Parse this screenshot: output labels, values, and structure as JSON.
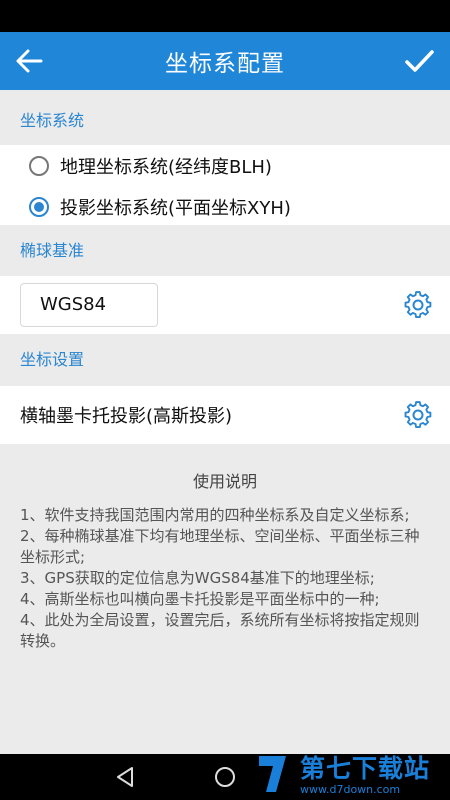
{
  "appbar": {
    "title": "坐标系配置",
    "back_icon": "arrow-left-icon",
    "confirm_icon": "check-icon"
  },
  "coordinate_system": {
    "header": "坐标系统",
    "options": [
      {
        "label": "地理坐标系统(经纬度BLH)",
        "selected": false
      },
      {
        "label": "投影坐标系统(平面坐标XYH)",
        "selected": true
      }
    ]
  },
  "ellipsoid": {
    "header": "椭球基准",
    "value": "WGS84",
    "settings_icon": "gear-icon"
  },
  "coordinate_settings": {
    "header": "坐标设置",
    "value": "横轴墨卡托投影(高斯投影)",
    "settings_icon": "gear-icon"
  },
  "instructions": {
    "title": "使用说明",
    "lines": [
      "1、软件支持我国范围内常用的四种坐标系及自定义坐标系;",
      "2、每种椭球基准下均有地理坐标、空间坐标、平面坐标三种坐标形式;",
      "3、GPS获取的定位信息为WGS84基准下的地理坐标;",
      "4、高斯坐标也叫横向墨卡托投影是平面坐标中的一种;",
      "4、此处为全局设置，设置完后，系统所有坐标将按指定规则转换。"
    ]
  },
  "watermark": {
    "name": "第七下载站",
    "url": "www.d7down.com"
  },
  "colors": {
    "accent": "#1f86d8",
    "section_text": "#2a86d0",
    "background": "#ebebeb"
  }
}
